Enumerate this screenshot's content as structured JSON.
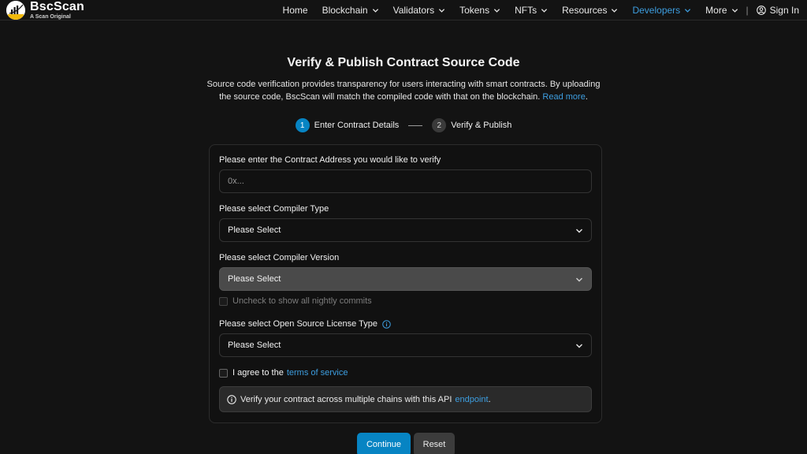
{
  "header": {
    "brand": "BscScan",
    "tagline": "A Scan Original",
    "nav": [
      {
        "label": "Home",
        "has_dropdown": false,
        "active": false
      },
      {
        "label": "Blockchain",
        "has_dropdown": true,
        "active": false
      },
      {
        "label": "Validators",
        "has_dropdown": true,
        "active": false
      },
      {
        "label": "Tokens",
        "has_dropdown": true,
        "active": false
      },
      {
        "label": "NFTs",
        "has_dropdown": true,
        "active": false
      },
      {
        "label": "Resources",
        "has_dropdown": true,
        "active": false
      },
      {
        "label": "Developers",
        "has_dropdown": true,
        "active": true
      },
      {
        "label": "More",
        "has_dropdown": true,
        "active": false
      }
    ],
    "separator": "|",
    "signin_label": "Sign In"
  },
  "main": {
    "title": "Verify & Publish Contract Source Code",
    "intro_text": "Source code verification provides transparency for users interacting with smart contracts. By uploading the source code, BscScan will match the compiled code with that on the blockchain.",
    "read_more": "Read more",
    "intro_end": ".",
    "steps": [
      {
        "number": "1",
        "label": "Enter Contract Details",
        "active": true
      },
      {
        "number": "2",
        "label": "Verify & Publish",
        "active": false
      }
    ]
  },
  "form": {
    "address_label": "Please enter the Contract Address you would like to verify",
    "address_placeholder": "0x...",
    "compiler_type_label": "Please select Compiler Type",
    "compiler_type_value": "Please Select",
    "compiler_version_label": "Please select Compiler Version",
    "compiler_version_value": "Please Select",
    "nightly_label": "Uncheck to show all nightly commits",
    "license_label": "Please select Open Source License Type",
    "license_value": "Please Select",
    "terms_prefix": "I agree to the",
    "terms_link": "terms of service",
    "notice_text": "Verify your contract across multiple chains with this API",
    "notice_link": "endpoint",
    "notice_end": ".",
    "continue_label": "Continue",
    "reset_label": "Reset"
  },
  "colors": {
    "background": "#131313",
    "accent": "#0784c3",
    "link": "#3d9ee0"
  }
}
